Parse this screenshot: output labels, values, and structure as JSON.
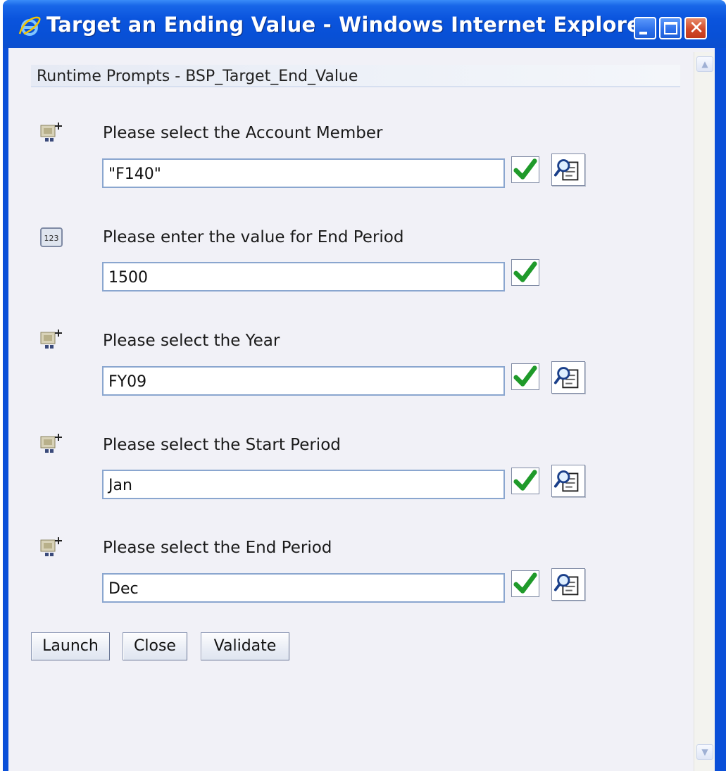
{
  "window": {
    "title": "Target an Ending Value - Windows Internet Explorer",
    "icon": "ie-icon",
    "controls": [
      "minimize-icon",
      "maximize-icon",
      "close-icon"
    ]
  },
  "header": {
    "text": "Runtime Prompts - BSP_Target_End_Value"
  },
  "prompts": [
    {
      "label": "Please select the Account Member",
      "value": "\"F140\"",
      "icon": "member-selection-icon",
      "has_lookup": true
    },
    {
      "label": "Please enter the value for End Period",
      "value": "1500",
      "icon": "numeric-123-icon",
      "has_lookup": false
    },
    {
      "label": "Please select the Year",
      "value": "FY09",
      "icon": "member-selection-icon",
      "has_lookup": true
    },
    {
      "label": "Please select the Start Period",
      "value": "Jan",
      "icon": "member-selection-icon",
      "has_lookup": true
    },
    {
      "label": "Please select the End Period",
      "value": "Dec",
      "icon": "member-selection-icon",
      "has_lookup": true
    }
  ],
  "buttons": {
    "launch": "Launch",
    "close": "Close",
    "validate": "Validate"
  },
  "colors": {
    "titlebar": "#0a54dd",
    "check": "#1f9a2a",
    "client_bg": "#f1f1f7"
  }
}
